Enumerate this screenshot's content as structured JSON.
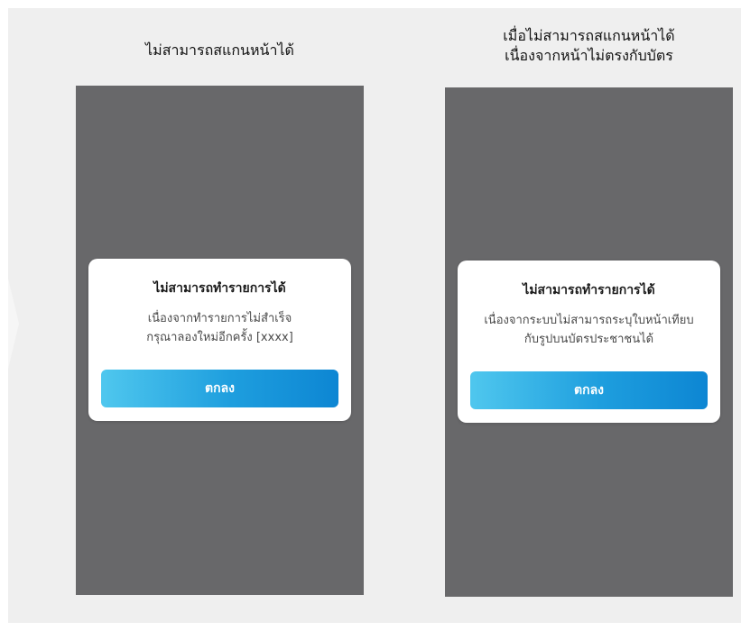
{
  "screens": [
    {
      "caption_lines": [
        "ไม่สามารถสแกนหน้าได้"
      ],
      "dialog": {
        "title": "ไม่สามารถทำรายการได้",
        "message_lines": [
          "เนื่องจากทำรายการไม่สำเร็จ",
          "กรุณาลองใหม่อีกครั้ง [xxxx]"
        ],
        "ok_label": "ตกลง"
      }
    },
    {
      "caption_lines": [
        "เมื่อไม่สามารถสแกนหน้าได้",
        "เนื่องจากหน้าไม่ตรงกับบัตร"
      ],
      "dialog": {
        "title": "ไม่สามารถทำรายการได้",
        "message_lines": [
          "เนื่องจากระบบไม่สามารถระบุใบหน้าเทียบ",
          "กับรูปบนบัตรประชาชนได้"
        ],
        "ok_label": "ตกลง"
      }
    }
  ],
  "colors": {
    "board_background": "#efefef",
    "phone_background": "#68686a",
    "button_gradient_start": "#4fc7ee",
    "button_gradient_end": "#0d86d3"
  }
}
